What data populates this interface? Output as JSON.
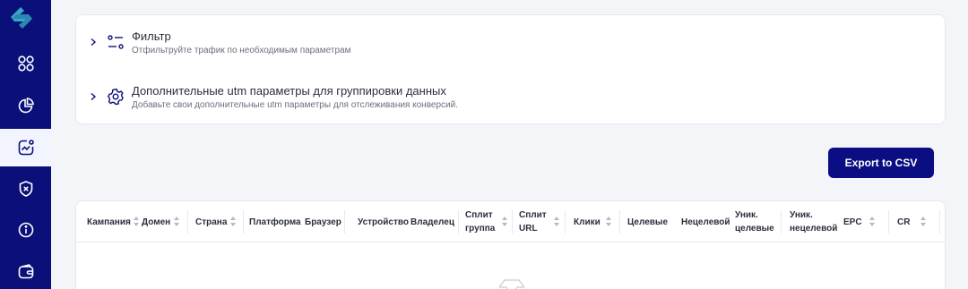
{
  "sidebar": {
    "logo": "logo-arrows-icon",
    "items": [
      {
        "name": "dashboard",
        "icon": "grid-icon",
        "active": false
      },
      {
        "name": "statistics",
        "icon": "pie-chart-icon",
        "active": false
      },
      {
        "name": "analytics",
        "icon": "trend-chart-icon",
        "active": true
      },
      {
        "name": "security",
        "icon": "shield-x-icon",
        "active": false
      },
      {
        "name": "info",
        "icon": "info-icon",
        "active": false
      },
      {
        "name": "wallet",
        "icon": "wallet-icon",
        "active": false
      }
    ]
  },
  "filters": [
    {
      "title": "Фильтр",
      "subtitle": "Отфильтруйте трафик по необходимым параметрам",
      "icon": "sliders-icon"
    },
    {
      "title": "Дополнительные utm параметры для группировки данных",
      "subtitle": "Добавьте свои дополнительные utm параметры для отслеживания конверсий.",
      "icon": "gear-icon"
    }
  ],
  "export_label": "Export to CSV",
  "table": {
    "columns": [
      {
        "label": "Кампания",
        "sortable": true
      },
      {
        "label": "Домен",
        "sortable": true
      },
      {
        "label": "Страна",
        "sortable": true
      },
      {
        "label": "Платформа",
        "sortable": false
      },
      {
        "label": "Браузер",
        "sortable": false
      },
      {
        "label": "Устройство",
        "sortable": false
      },
      {
        "label": "Владелец",
        "sortable": false
      },
      {
        "label": "Сплит\nгруппа",
        "sortable": true
      },
      {
        "label": "Сплит\nURL",
        "sortable": true
      },
      {
        "label": "Клики",
        "sortable": true
      },
      {
        "label": "Целевые",
        "sortable": false
      },
      {
        "label": "Нецелевой",
        "sortable": false
      },
      {
        "label": "Уник.\nцелевые",
        "sortable": false
      },
      {
        "label": "Уник.\nнецелевой",
        "sortable": false
      },
      {
        "label": "EPC",
        "sortable": true
      },
      {
        "label": "CR",
        "sortable": true
      }
    ]
  },
  "colors": {
    "sidebar_bg": "#0a0f7a",
    "accent": "#0b0e82",
    "active_item_bg": "#f2f5ff",
    "page_bg": "#f4f5f8"
  }
}
